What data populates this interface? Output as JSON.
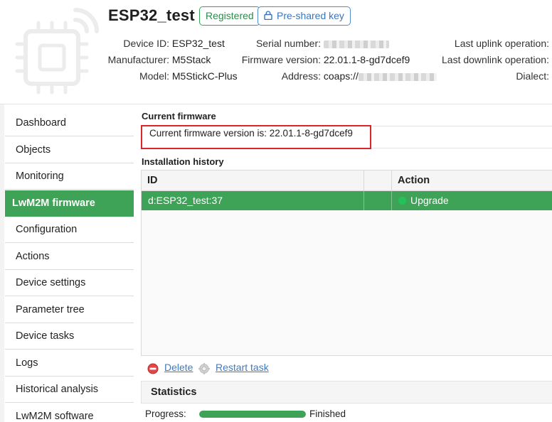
{
  "device": {
    "title": "ESP32_test",
    "status_badge": "Registered",
    "key_badge": "Pre-shared key"
  },
  "info": {
    "col1": [
      {
        "label": "Device ID:",
        "value": "ESP32_test"
      },
      {
        "label": "Manufacturer:",
        "value": "M5Stack"
      },
      {
        "label": "Model:",
        "value": "M5StickC-Plus"
      }
    ],
    "col2": [
      {
        "label": "Serial number:",
        "value": ""
      },
      {
        "label": "Firmware version:",
        "value": "22.01.1-8-gd7dcef9"
      },
      {
        "label": "Address:",
        "value": "coaps://"
      }
    ],
    "col3": [
      {
        "label": "Last uplink operation:"
      },
      {
        "label": "Last downlink operation:"
      },
      {
        "label": "Dialect:"
      }
    ]
  },
  "sidebar": {
    "items": [
      {
        "label": "Dashboard"
      },
      {
        "label": "Objects"
      },
      {
        "label": "Monitoring"
      },
      {
        "label": "LwM2M firmware"
      },
      {
        "label": "Configuration"
      },
      {
        "label": "Actions"
      },
      {
        "label": "Device settings"
      },
      {
        "label": "Parameter tree"
      },
      {
        "label": "Device tasks"
      },
      {
        "label": "Logs"
      },
      {
        "label": "Historical analysis"
      },
      {
        "label": "LwM2M software"
      }
    ],
    "active_index": 3
  },
  "current_firmware": {
    "title": "Current firmware",
    "text": "Current firmware version is: 22.01.1-8-gd7dcef9"
  },
  "history": {
    "title": "Installation history",
    "columns": [
      "ID",
      "",
      "Action"
    ],
    "rows": [
      {
        "id": "d:ESP32_test:37",
        "blank": "",
        "action": "Upgrade"
      }
    ]
  },
  "actions": {
    "delete_label": "Delete",
    "restart_label": "Restart task"
  },
  "statistics": {
    "title": "Statistics",
    "progress_label": "Progress:",
    "progress_percent": 100,
    "progress_status": "Finished"
  },
  "colors": {
    "accent_green": "#3ea356",
    "status_dot": "#25c15a",
    "highlight_red": "#d9262c",
    "link_blue": "#3f7bc2"
  }
}
